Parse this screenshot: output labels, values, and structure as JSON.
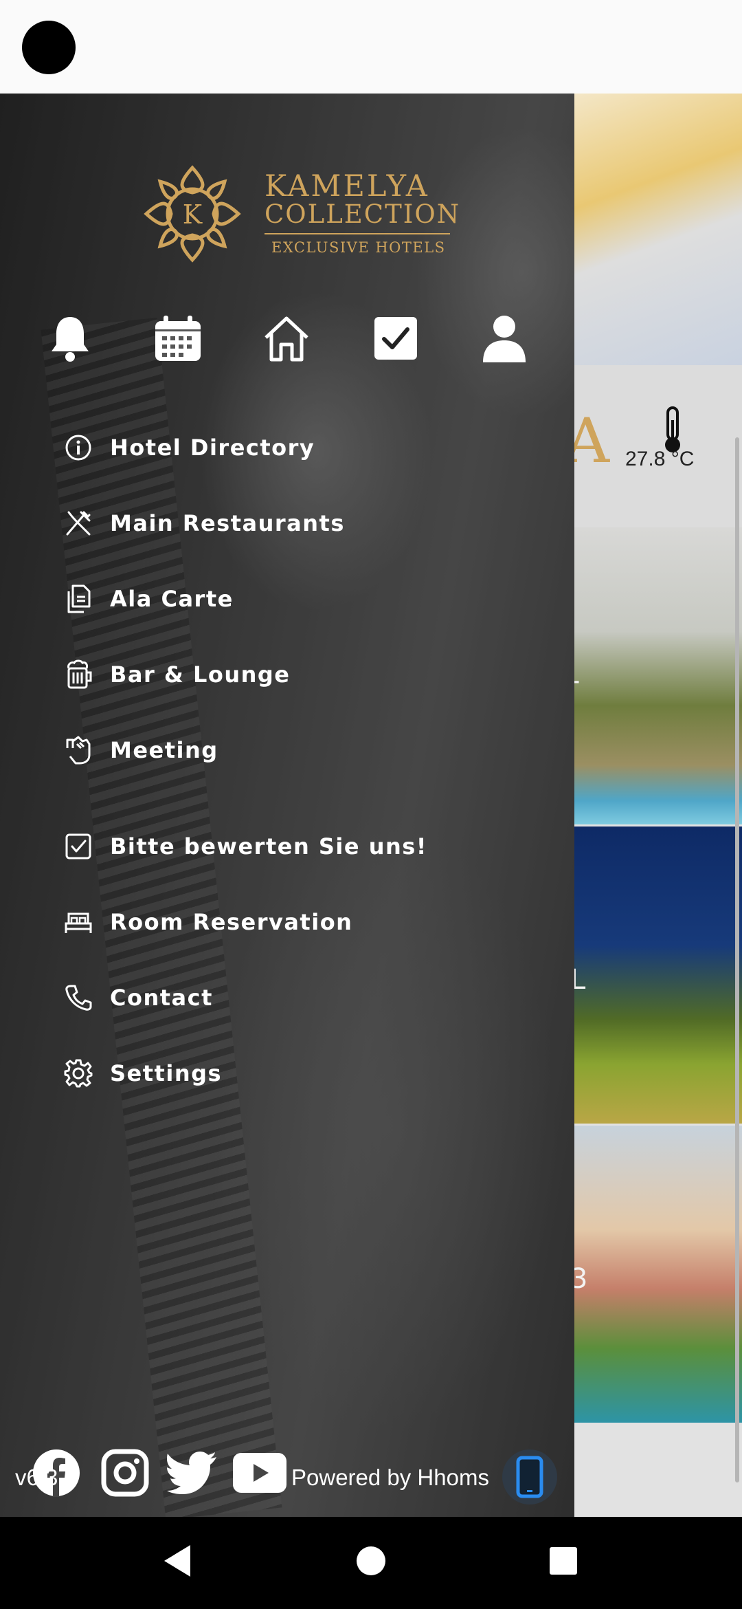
{
  "background": {
    "weather": {
      "icon": "thermometer-icon",
      "temperature": "27.8 °C"
    },
    "tile_letters": [
      "-",
      "L",
      "3"
    ],
    "partial_logo_letter": "A"
  },
  "drawer": {
    "logo": {
      "line1": "KAMELYA",
      "line2": "COLLECTION",
      "line3": "EXCLUSIVE HOTELS",
      "monogram": "K",
      "color": "#cfa45c"
    },
    "quick_actions": [
      {
        "name": "notifications",
        "icon": "bell-icon"
      },
      {
        "name": "calendar",
        "icon": "calendar-icon"
      },
      {
        "name": "home",
        "icon": "home-icon"
      },
      {
        "name": "tasks",
        "icon": "checkbox-icon"
      },
      {
        "name": "profile",
        "icon": "user-icon"
      }
    ],
    "menu": [
      {
        "label": "Hotel Directory",
        "icon": "info-icon"
      },
      {
        "label": "Main Restaurants",
        "icon": "fork-knife-icon"
      },
      {
        "label": "Ala Carte",
        "icon": "documents-icon"
      },
      {
        "label": "Bar & Lounge",
        "icon": "beer-mug-icon"
      },
      {
        "label": "Meeting",
        "icon": "handshake-icon"
      },
      {
        "label": "Bitte bewerten Sie uns!",
        "icon": "checkbox-icon"
      },
      {
        "label": "Room Reservation",
        "icon": "bed-icon"
      },
      {
        "label": "Contact",
        "icon": "phone-icon"
      },
      {
        "label": "Settings",
        "icon": "gear-icon"
      }
    ],
    "social": [
      {
        "name": "facebook",
        "icon": "facebook-icon"
      },
      {
        "name": "instagram",
        "icon": "instagram-icon"
      },
      {
        "name": "twitter",
        "icon": "twitter-icon"
      },
      {
        "name": "youtube",
        "icon": "youtube-icon"
      }
    ],
    "footer": {
      "version": "v6.3.5",
      "powered_by": "Powered by Hhoms",
      "powered_icon": "hhoms-phone-icon"
    }
  },
  "system_nav": {
    "back": "back-icon",
    "home": "home-circle-icon",
    "recents": "recents-icon"
  }
}
